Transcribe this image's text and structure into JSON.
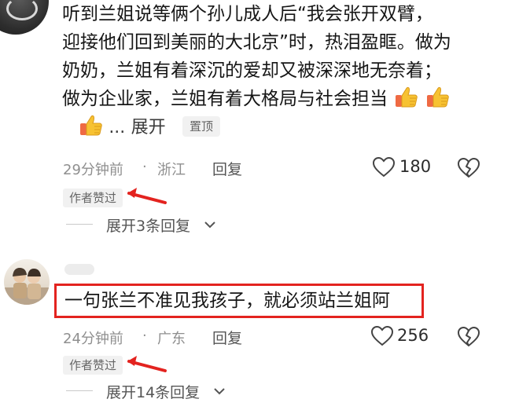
{
  "comment1": {
    "lines": [
      "听到兰姐说等俩个孙儿成人后“我会张开双臂，",
      "迎接他们回到美丽的大北京”时，热泪盈眶。做为",
      "奶奶，兰姐有着深沉的爱却又被深深地无奈着；",
      "做为企业家，兰姐有着大格局与社会担当"
    ],
    "ellipsis": "...",
    "expand_label": "展开",
    "pin_tag": "置顶",
    "time": "29分钟前",
    "separator": "·",
    "location": "浙江",
    "reply_label": "回复",
    "like_count": "180",
    "author_liked_tag": "作者赞过",
    "expand_replies_label": "展开3条回复"
  },
  "comment2": {
    "text": "一句张兰不准见我孩子，就必须站兰姐阿",
    "time": "24分钟前",
    "separator": "·",
    "location": "广东",
    "reply_label": "回复",
    "like_count": "256",
    "author_liked_tag": "作者赞过",
    "expand_replies_label": "展开14条回复"
  },
  "icons": {
    "emoji": "thumbs-up-emoji",
    "like": "heart-outline-icon",
    "dislike": "broken-heart-icon",
    "expand_chevron": "chevron-down-icon",
    "annotation_arrow": "red-arrow-annotation"
  },
  "colors": {
    "annotation_red": "#e3231f",
    "meta_gray": "#8f8f8f",
    "tag_bg": "#f1f1f1",
    "thumb_yellow": "#f7c232",
    "thumb_cuff": "#ef6a43"
  }
}
